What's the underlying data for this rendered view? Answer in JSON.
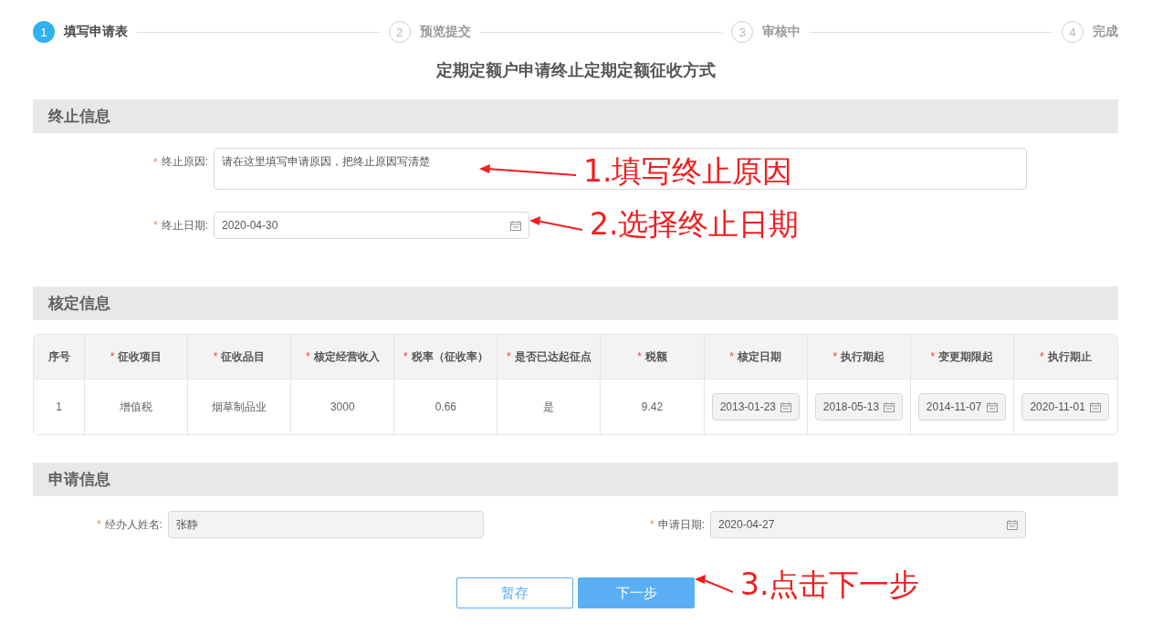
{
  "steps": [
    {
      "number": "1",
      "label": "填写申请表",
      "selected": true
    },
    {
      "number": "2",
      "label": "预览提交",
      "selected": false
    },
    {
      "number": "3",
      "label": "审核中",
      "selected": false
    },
    {
      "number": "4",
      "label": "完成",
      "selected": false
    }
  ],
  "title": "定期定额户申请终止定期定额征收方式",
  "termination": {
    "heading": "终止信息",
    "fields": [
      {
        "kind": "textarea",
        "marker": "*",
        "label": "终止原因:",
        "value": "请在这里填写申请原因，把终止原因写清楚",
        "annotation": "1.填写终止原因"
      },
      {
        "kind": "date",
        "marker": "*",
        "label": "终止日期:",
        "value": "2020-04-30",
        "annotation": "2.选择终止日期"
      }
    ]
  },
  "assessment": {
    "heading": "核定信息",
    "table": {
      "columns": [
        {
          "label": "序号"
        },
        {
          "marker": "*",
          "label": "征收项目"
        },
        {
          "marker": "*",
          "label": "征收品目"
        },
        {
          "marker": "*",
          "label": "核定经营收入"
        },
        {
          "marker": "*",
          "label": "税率（征收率）"
        },
        {
          "marker": "*",
          "label": "是否已达起征点"
        },
        {
          "marker": "*",
          "label": "税额"
        },
        {
          "marker": "*",
          "label": "核定日期"
        },
        {
          "marker": "*",
          "label": "执行期起"
        },
        {
          "marker": "*",
          "label": "变更期限起"
        },
        {
          "marker": "*",
          "label": "执行期止"
        }
      ],
      "rows": [
        [
          {
            "kind": "text",
            "value": "1"
          },
          {
            "kind": "text",
            "value": "增值税"
          },
          {
            "kind": "text",
            "value": "烟草制品业"
          },
          {
            "kind": "text",
            "value": "3000"
          },
          {
            "kind": "text",
            "value": "0.66"
          },
          {
            "kind": "text",
            "value": "是"
          },
          {
            "kind": "text",
            "value": "9.42"
          },
          {
            "kind": "date",
            "value": "2013-01-23",
            "disabled": true
          },
          {
            "kind": "date",
            "value": "2018-05-13",
            "disabled": true
          },
          {
            "kind": "date",
            "value": "2014-11-07",
            "disabled": true
          },
          {
            "kind": "date",
            "value": "2020-11-01",
            "disabled": true
          }
        ]
      ]
    }
  },
  "application": {
    "heading": "申请信息",
    "fields": [
      {
        "kind": "text",
        "marker": "*",
        "label": "经办人姓名:",
        "value": "张静",
        "disabled": true
      },
      {
        "kind": "date",
        "marker": "*",
        "label": "申请日期:",
        "value": "2020-04-27",
        "disabled": true
      }
    ]
  },
  "buttons": [
    {
      "label": "暂存",
      "primary": false
    },
    {
      "label": "下一步",
      "primary": true,
      "annotation": "3.点击下一步"
    }
  ]
}
